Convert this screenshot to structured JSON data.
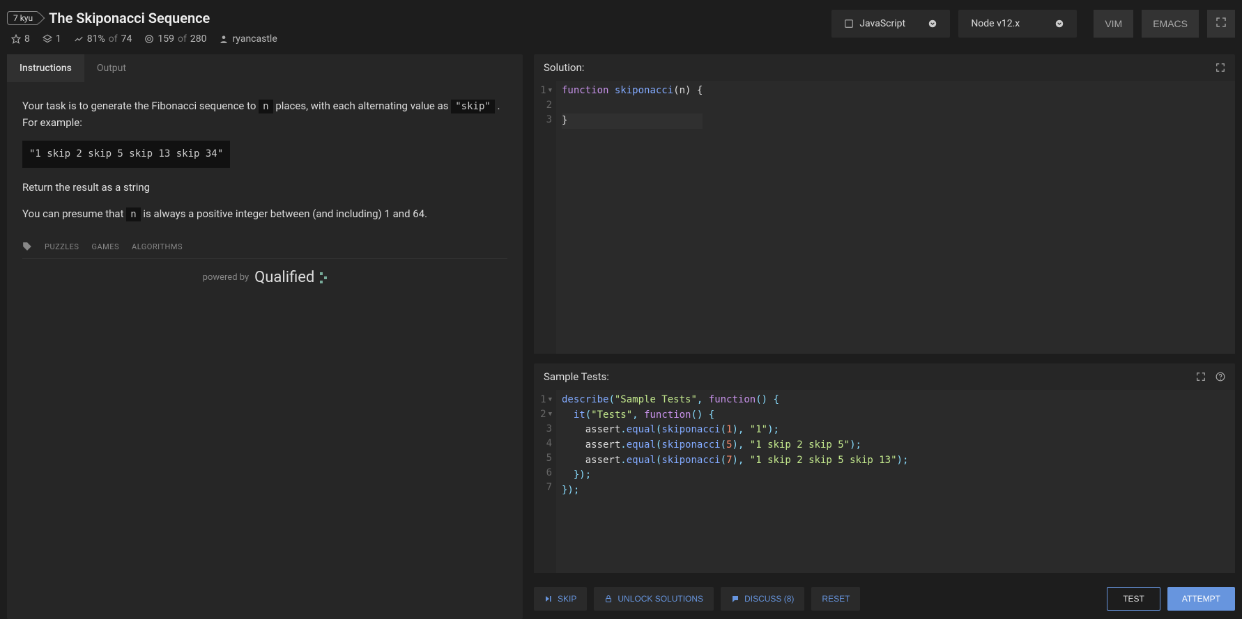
{
  "header": {
    "kyu": "7 kyu",
    "title": "The Skiponacci Sequence",
    "stats": {
      "bookmarks": "8",
      "collections": "1",
      "satisfaction_pct": "81%",
      "satisfaction_of": "of",
      "satisfaction_total": "74",
      "completed": "159",
      "completed_of": "of",
      "completed_total": "280",
      "author": "ryancastle"
    }
  },
  "dropdowns": {
    "language": "JavaScript",
    "version": "Node v12.x"
  },
  "editor_modes": {
    "vim": "VIM",
    "emacs": "EMACS"
  },
  "tabs": {
    "instructions": "Instructions",
    "output": "Output"
  },
  "description": {
    "p1_a": "Your task is to generate the Fibonacci sequence to ",
    "p1_code1": "n",
    "p1_b": " places, with each alternating value as ",
    "p1_code2": "\"skip\"",
    "p1_c": " . For example:",
    "example": "\"1 skip 2 skip 5 skip 13 skip 34\"",
    "p2": "Return the result as a string",
    "p3_a": "You can presume that ",
    "p3_code": "n",
    "p3_b": " is always a positive integer between (and including) 1 and 64."
  },
  "tags": [
    "PUZZLES",
    "GAMES",
    "ALGORITHMS"
  ],
  "powered": {
    "by": "powered by",
    "brand": "Qualified"
  },
  "panels": {
    "solution_title": "Solution:",
    "tests_title": "Sample Tests:"
  },
  "solution_code": {
    "lines": [
      "1",
      "2",
      "3"
    ],
    "l1_kw": "function",
    "l1_fn": "skiponacci",
    "l1_rest": "(n) {",
    "l2": "",
    "l3": "}"
  },
  "tests_code": {
    "lines": [
      "1",
      "2",
      "3",
      "4",
      "5",
      "6",
      "7"
    ]
  },
  "actions": {
    "skip": "SKIP",
    "unlock": "UNLOCK SOLUTIONS",
    "discuss": "DISCUSS (8)",
    "reset": "RESET",
    "test": "TEST",
    "attempt": "ATTEMPT"
  }
}
